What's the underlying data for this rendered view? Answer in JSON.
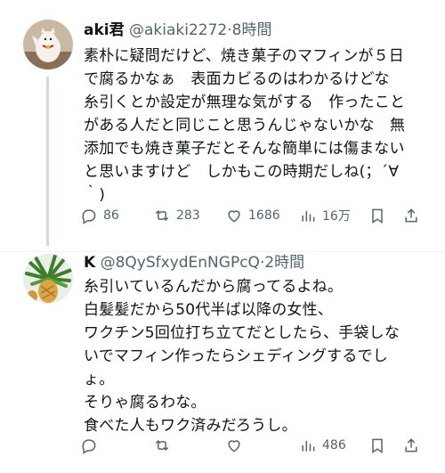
{
  "tweets": [
    {
      "name": "aki君",
      "handle": "@akiaki2272",
      "sep": "·",
      "time": "8時間",
      "lines": [
        "素朴に疑問だけど、焼き菓子のマフィンが５日",
        "で腐るかなぁ　表面カビるのはわかるけどな",
        "糸引くとか設定が無理な気がする　作ったこと",
        "がある人だと同じこと思うんじゃないかな　無",
        "添加でも焼き菓子だとそんな簡単には傷まない",
        "と思いますけど　しかもこの時期だしね(；´∀",
        "｀)"
      ],
      "stats": {
        "replies": "86",
        "retweets": "283",
        "likes": "1686",
        "views": "16万"
      }
    },
    {
      "name": "K",
      "handle": "@8QySfxydEnNGPcQ",
      "sep": "·",
      "time": "2時間",
      "lines": [
        "糸引いているんだから腐ってるよね。",
        "白髪髪だから50代半ば以降の女性、",
        "ワクチン5回位打ち立てだとしたら、手袋しな",
        "いでマフィン作ったらシェディングするでし",
        "ょ。",
        "そりゃ腐るわな。",
        "食べた人もワク済みだろうし。"
      ],
      "stats": {
        "replies": "",
        "retweets": "",
        "likes": "",
        "views": "486"
      }
    }
  ],
  "colors": {
    "text": "#0f1419",
    "secondary": "#536471",
    "thread_line": "#cfd9de"
  },
  "icons": [
    "reply-icon",
    "retweet-icon",
    "like-icon",
    "views-icon",
    "bookmark-icon",
    "share-icon"
  ]
}
